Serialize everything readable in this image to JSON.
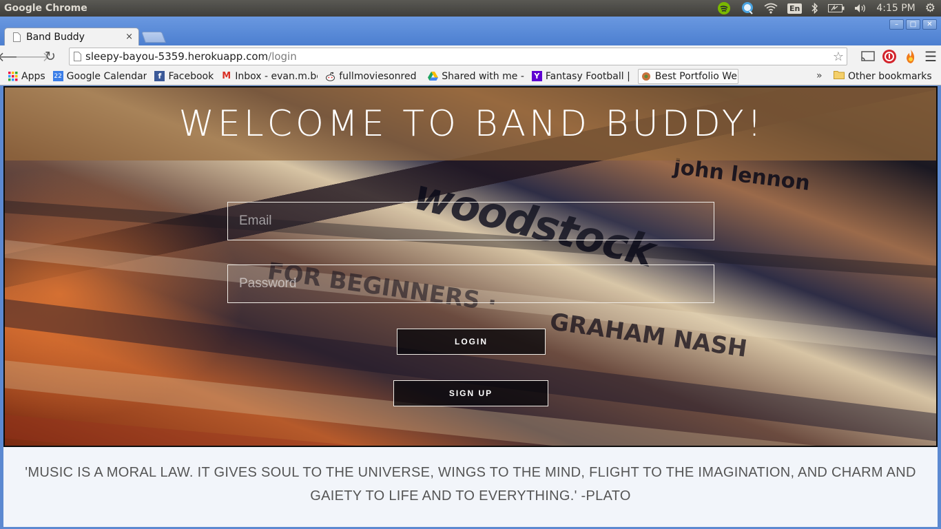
{
  "os_panel": {
    "app_name": "Google Chrome",
    "keyboard_layout": "En",
    "time": "4:15 PM",
    "tray_icons": [
      "spotify-icon",
      "chat-icon",
      "wifi-icon",
      "keyboard-icon",
      "bluetooth-icon",
      "battery-icon",
      "volume-icon",
      "gear-icon"
    ]
  },
  "browser": {
    "tab": {
      "title": "Band Buddy",
      "close": "×"
    },
    "address": {
      "host": "sleepy-bayou-5359.herokuapp.com",
      "path": "/login"
    },
    "bookmarks": [
      {
        "label": "Apps",
        "icon": "apps-grid-icon"
      },
      {
        "label": "Google Calendar",
        "icon": "calendar-icon"
      },
      {
        "label": "Facebook",
        "icon": "facebook-icon"
      },
      {
        "label": "Inbox - evan.m.be",
        "icon": "gmail-icon"
      },
      {
        "label": "fullmoviesonred",
        "icon": "reddit-icon"
      },
      {
        "label": "Shared with me -",
        "icon": "drive-icon"
      },
      {
        "label": "Fantasy Football |",
        "icon": "yahoo-icon"
      },
      {
        "label": "Best Portfolio We",
        "icon": "site-icon"
      }
    ],
    "bookmarks_more": "»",
    "other_bookmarks": "Other bookmarks",
    "calendar_day": "22"
  },
  "page": {
    "title": "WELCOME TO BAND BUDDY!",
    "email_placeholder": "Email",
    "password_placeholder": "Password",
    "login_label": "LOGIN",
    "signup_label": "SIGN UP",
    "quote": "'MUSIC IS A MORAL LAW. IT GIVES SOUL TO THE UNIVERSE, WINGS TO THE MIND, FLIGHT TO THE IMAGINATION, AND CHARM AND GAIETY TO LIFE AND TO EVERYTHING.' -PLATO"
  },
  "colors": {
    "chrome_frame": "#5c89d1",
    "banner": "#96693c",
    "button_bg": "#05050a"
  }
}
